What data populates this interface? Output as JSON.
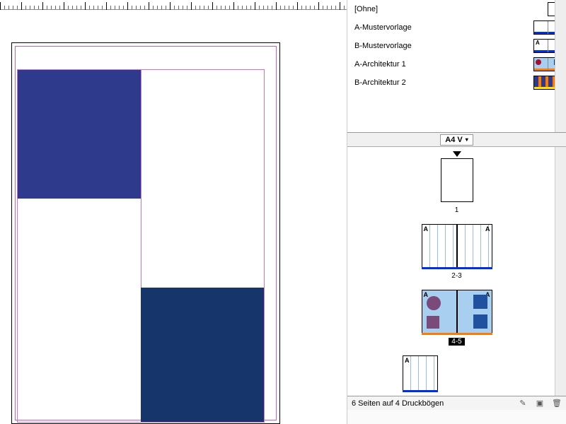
{
  "masters": {
    "items": [
      {
        "label": "[Ohne]"
      },
      {
        "label": "A-Mustervorlage"
      },
      {
        "label": "B-Mustervorlage"
      },
      {
        "label": "A-Architektur 1"
      },
      {
        "label": "B-Architektur 2"
      }
    ]
  },
  "pagesPanel": {
    "size_label": "A4 V",
    "page1_label": "1",
    "spread23_label": "2-3",
    "spread45_label": "4-5",
    "master_letter": "A"
  },
  "footer": {
    "status": "6 Seiten auf 4 Druckbögen"
  }
}
